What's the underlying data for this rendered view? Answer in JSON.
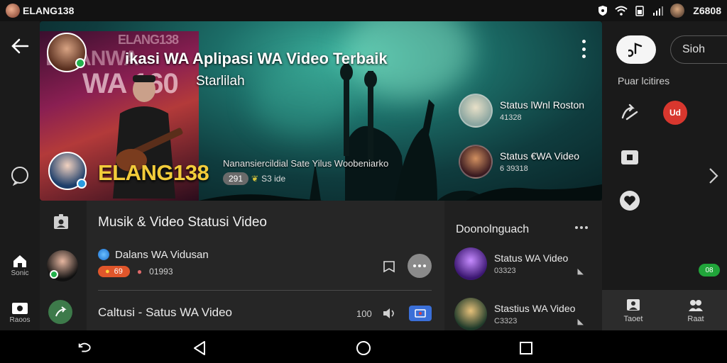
{
  "status_bar": {
    "app_name": "ELANG138",
    "clock": "Z6808"
  },
  "left_rail": {
    "items": [
      {
        "label": "Sonic"
      },
      {
        "label": "Raoos"
      }
    ]
  },
  "hero": {
    "title": "ikasi WA Aplipasi WA Video Terbaik",
    "subtitle": "Starlilah",
    "poster_text_top": "ELANG138",
    "poster_text_mid": "EIPANWA",
    "poster_text_big": "WA 160",
    "brand": "ELANG138",
    "caption": "Nanansiercildial Sate Yilus Woobeniarko",
    "chip_count": "291",
    "chip_text": "S3 ide",
    "cards": [
      {
        "title": "Status lWnl Roston",
        "meta": "41328"
      },
      {
        "title": "Status €WA Video",
        "meta": "6 39318"
      }
    ]
  },
  "list": {
    "title": "Musik & Video Statusi Video",
    "row1_name": "Dalans WA Vidusan",
    "row1_pill": "69",
    "row1_meta": "01993",
    "row2_title": "Caltusi - Satus WA Video",
    "row2_count": "100"
  },
  "downloads": {
    "title": "Doonolnguach",
    "items": [
      {
        "title": "Status WA Video",
        "meta": "03323"
      },
      {
        "title": "Stastius WA Video",
        "meta": "C3323"
      }
    ]
  },
  "right_panel": {
    "search_placeholder": "Sioh",
    "section_label": "Puar lcitires",
    "red_badge": "Ud",
    "green_pill": "08",
    "tabs": [
      {
        "label": "Taoet"
      },
      {
        "label": "Raat"
      }
    ]
  }
}
